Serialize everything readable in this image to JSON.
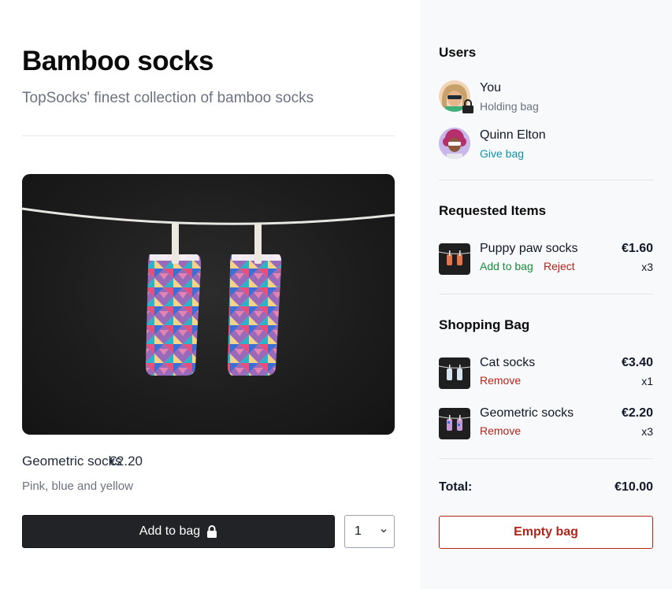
{
  "product": {
    "title": "Bamboo socks",
    "subtitle": "TopSocks' finest collection of bamboo socks",
    "name": "Geometric socks",
    "price": "€2.20",
    "color": "Pink, blue and yellow",
    "image_icon": "socks-on-clothesline-image",
    "add_to_bag_label": "Add to bag",
    "add_to_bag_icon": "lock-icon",
    "quantity": "1"
  },
  "sidebar": {
    "users_title": "Users",
    "users": [
      {
        "name": "You",
        "status": "Holding bag",
        "avatar_icon": "avatar-woman-sunglasses",
        "badge_icon": "lock-icon"
      },
      {
        "name": "Quinn Elton",
        "action": "Give bag",
        "avatar_icon": "avatar-woman-curly-hair"
      }
    ],
    "requested_title": "Requested Items",
    "requested": [
      {
        "name": "Puppy paw socks",
        "price": "€1.60",
        "qty": "x3",
        "accept": "Add to bag",
        "reject": "Reject"
      }
    ],
    "bag_title": "Shopping Bag",
    "bag": [
      {
        "name": "Cat socks",
        "price": "€3.40",
        "qty": "x1",
        "remove": "Remove"
      },
      {
        "name": "Geometric socks",
        "price": "€2.20",
        "qty": "x3",
        "remove": "Remove"
      }
    ],
    "total_label": "Total:",
    "total_value": "€10.00",
    "empty_label": "Empty bag"
  },
  "colors": {
    "accent_teal": "#0e93a8",
    "accept_green": "#1a8a3c",
    "danger_red": "#b42318",
    "button_dark": "#222326"
  }
}
